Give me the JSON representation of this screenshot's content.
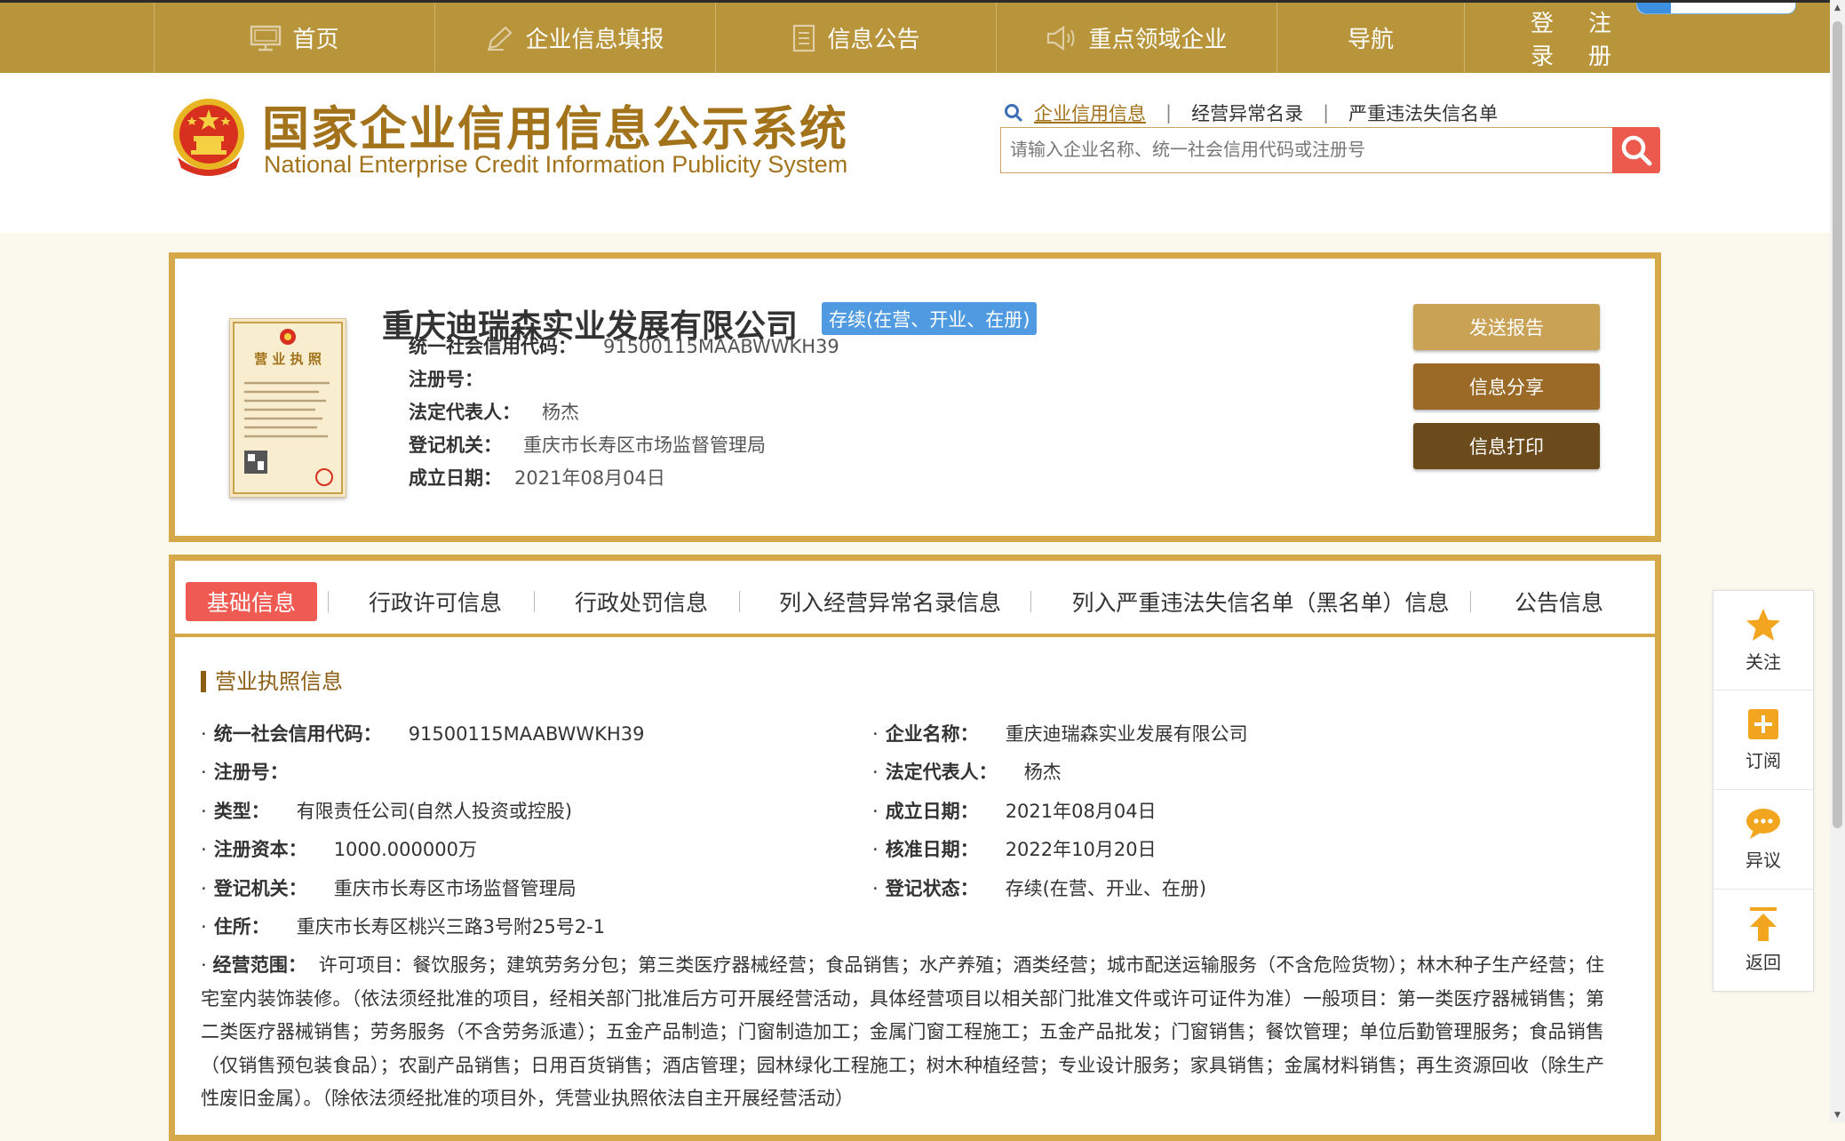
{
  "nav": {
    "items": [
      {
        "label": "首页",
        "icon": "monitor-icon"
      },
      {
        "label": "企业信息填报",
        "icon": "pen-icon"
      },
      {
        "label": "信息公告",
        "icon": "document-icon"
      },
      {
        "label": "重点领域企业",
        "icon": "speaker-icon"
      },
      {
        "label": "导航",
        "icon": ""
      }
    ],
    "login": "登录",
    "register": "注册"
  },
  "header": {
    "title": "国家企业信用信息公示系统",
    "subtitle": "National Enterprise Credit Information Publicity System",
    "search_tabs": [
      "企业信用信息",
      "经营异常名录",
      "严重违法失信名单"
    ],
    "search_placeholder": "请输入企业名称、统一社会信用代码或注册号"
  },
  "company": {
    "name": "重庆迪瑞森实业发展有限公司",
    "status": "存续(在营、开业、在册)",
    "fields": [
      {
        "label": "统一社会信用代码：",
        "value": "91500115MAABWWKH39"
      },
      {
        "label": "注册号：",
        "value": ""
      },
      {
        "label": "法定代表人：",
        "value": "杨杰"
      },
      {
        "label": "登记机关：",
        "value": "重庆市长寿区市场监督管理局"
      },
      {
        "label": "成立日期：",
        "value": "2021年08月04日"
      }
    ],
    "license_title": "营 业 执 照"
  },
  "actions": {
    "send_report": "发送报告",
    "share": "信息分享",
    "print": "信息打印"
  },
  "tabs": [
    "基础信息",
    "行政许可信息",
    "行政处罚信息",
    "列入经营异常名录信息",
    "列入严重违法失信名单（黑名单）信息",
    "公告信息"
  ],
  "license_section": {
    "title": "营业执照信息",
    "left": [
      {
        "label": "统一社会信用代码：",
        "value": "91500115MAABWWKH39"
      },
      {
        "label": "注册号：",
        "value": ""
      },
      {
        "label": "类型：",
        "value": "有限责任公司(自然人投资或控股)"
      },
      {
        "label": "注册资本：",
        "value": "1000.000000万"
      },
      {
        "label": "登记机关：",
        "value": "重庆市长寿区市场监督管理局"
      },
      {
        "label": "住所：",
        "value": "重庆市长寿区桃兴三路3号附25号2-1"
      }
    ],
    "right": [
      {
        "label": "企业名称：",
        "value": "重庆迪瑞森实业发展有限公司"
      },
      {
        "label": "法定代表人：",
        "value": "杨杰"
      },
      {
        "label": "成立日期：",
        "value": "2021年08月04日"
      },
      {
        "label": "核准日期：",
        "value": "2022年10月20日"
      },
      {
        "label": "登记状态：",
        "value": "存续(在营、开业、在册)"
      }
    ],
    "scope_label": "经营范围：",
    "scope_text": "许可项目：餐饮服务；建筑劳务分包；第三类医疗器械经营；食品销售；水产养殖；酒类经营；城市配送运输服务（不含危险货物）；林木种子生产经营；住宅室内装饰装修。（依法须经批准的项目，经相关部门批准后方可开展经营活动，具体经营项目以相关部门批准文件或许可证件为准）一般项目：第一类医疗器械销售；第二类医疗器械销售；劳务服务（不含劳务派遣）；五金产品制造；门窗制造加工；金属门窗工程施工；五金产品批发；门窗销售；餐饮管理；单位后勤管理服务；食品销售（仅销售预包装食品）；农副产品销售；日用百货销售；酒店管理；园林绿化工程施工；树木种植经营；专业设计服务；家具销售；金属材料销售；再生资源回收（除生产性废旧金属）。（除依法须经批准的项目外，凭营业执照依法自主开展经营活动）"
  },
  "side": {
    "follow": "关注",
    "subscribe": "订阅",
    "objection": "异议",
    "back": "返回"
  },
  "colors": {
    "gold": "#b8943a",
    "border_gold": "#d5a94a",
    "title_brown": "#a3731b",
    "status_blue": "#4f9ae0",
    "tab_red": "#ef5b53",
    "btn1": "#c9a256",
    "btn2": "#9a6a26",
    "btn3": "#6b4a1c"
  }
}
